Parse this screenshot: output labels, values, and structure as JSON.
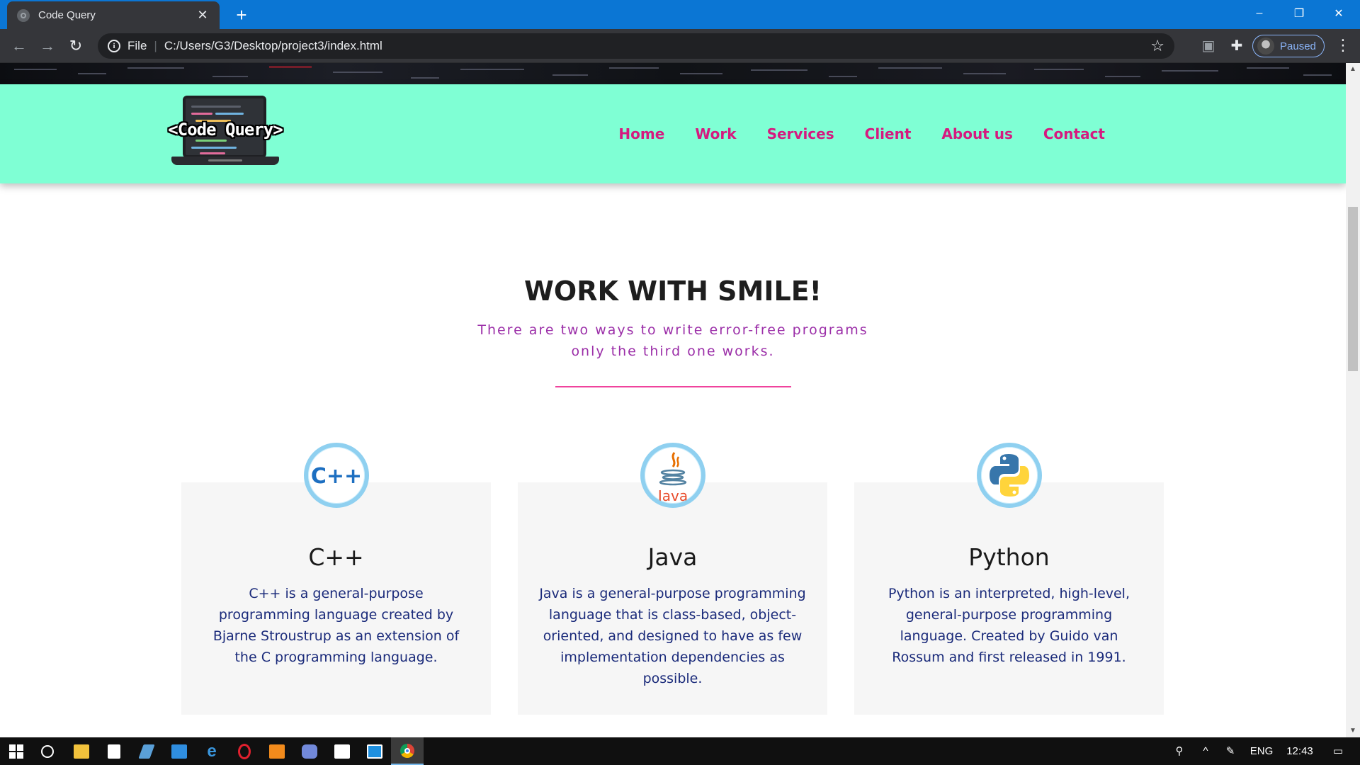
{
  "browser": {
    "tab_title": "Code Query",
    "tab_close": "✕",
    "new_tab": "+",
    "url_scheme": "File",
    "url_separator": "|",
    "url": "C:/Users/G3/Desktop/project3/index.html",
    "profile_status": "Paused",
    "window_controls": {
      "minimize": "–",
      "restore": "❐",
      "close": "✕"
    }
  },
  "site": {
    "logo_text": "<Code Query>",
    "nav": [
      "Home",
      "Work",
      "Services",
      "Client",
      "About us",
      "Contact"
    ],
    "colors": {
      "nav_bg": "#7fffd4",
      "nav_link": "#d51a7f",
      "subtitle": "#9b2ea8",
      "rule": "#f0439d",
      "badge_border": "#8fd0f0",
      "card_text": "#1a2a7a"
    }
  },
  "section": {
    "title": "WORK WITH SMILE!",
    "subtitle_line1": "There are two ways to write error-free programs",
    "subtitle_line2": "only the third one works."
  },
  "cards": [
    {
      "icon": "cpp-logo-icon",
      "logo_text": "C++",
      "title": "C++",
      "description": "C++ is a general-purpose programming language created by Bjarne Stroustrup as an extension of the C programming language."
    },
    {
      "icon": "java-logo-icon",
      "logo_text": "Java",
      "title": "Java",
      "description": "Java is a general-purpose programming language that is class-based, object-oriented, and designed to have as few implementation dependencies as possible."
    },
    {
      "icon": "python-logo-icon",
      "title": "Python",
      "description": "Python is an interpreted, high-level, general-purpose programming language. Created by Guido van Rossum and first released in 1991."
    }
  ],
  "taskbar": {
    "language": "ENG",
    "time": "12:43",
    "apps": [
      "start-icon",
      "cortana-icon",
      "file-explorer-icon",
      "store-icon",
      "app-icon",
      "mail-icon",
      "edge-icon",
      "opera-icon",
      "sublime-icon",
      "discord-icon",
      "photos-icon",
      "app-icon",
      "chrome-icon"
    ]
  }
}
